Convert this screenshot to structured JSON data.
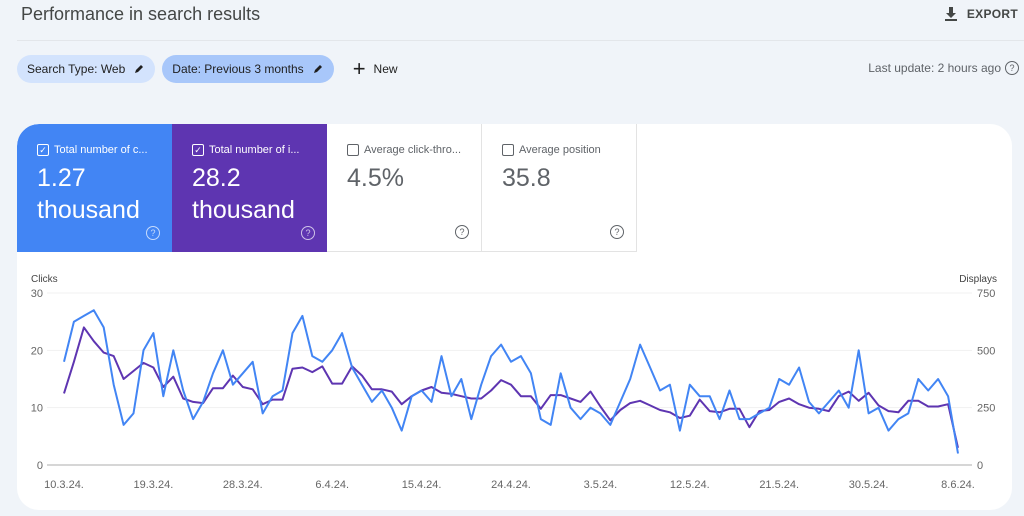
{
  "header": {
    "title": "Performance in search results",
    "export_label": "EXPORT"
  },
  "filters": {
    "chips": [
      {
        "label": "Search Type: Web"
      },
      {
        "label": "Date: Previous 3 months"
      }
    ],
    "new_label": "New",
    "last_update": "Last update: 2 hours ago"
  },
  "metrics": [
    {
      "label": "Total number of c...",
      "value_line1": "1.27",
      "value_line2": "thousand",
      "checked": true,
      "color": "#4285f4"
    },
    {
      "label": "Total number of i...",
      "value_line1": "28.2",
      "value_line2": "thousand",
      "checked": true,
      "color": "#5e35b1"
    },
    {
      "label": "Average click-thro...",
      "value_line1": "4.5%",
      "value_line2": "",
      "checked": false
    },
    {
      "label": "Average position",
      "value_line1": "35.8",
      "value_line2": "",
      "checked": false
    }
  ],
  "chart_data": {
    "type": "line",
    "ylabel_left": "Clicks",
    "ylabel_right": "Displays",
    "ylim_left": [
      0,
      30
    ],
    "ylim_right": [
      0,
      750
    ],
    "yticks_left": [
      "0",
      "10",
      "20",
      "30"
    ],
    "yticks_right": [
      "0",
      "250",
      "500",
      "750"
    ],
    "xtick_labels": [
      "10.3.24.",
      "19.3.24.",
      "28.3.24.",
      "6.4.24.",
      "15.4.24.",
      "24.4.24.",
      "3.5.24.",
      "12.5.24.",
      "21.5.24.",
      "30.5.24.",
      "8.6.24."
    ],
    "grid": true,
    "series": [
      {
        "name": "Clicks",
        "axis": "left",
        "color": "#4285f4",
        "values": [
          18,
          25,
          26,
          27,
          24,
          14,
          7,
          9,
          20,
          23,
          12,
          20,
          13,
          8,
          11,
          16,
          20,
          14,
          16,
          18,
          9,
          12,
          13,
          23,
          26,
          19,
          18,
          20,
          23,
          17,
          14,
          11,
          13,
          10,
          6,
          12,
          13,
          11,
          19,
          12,
          15,
          8,
          14,
          19,
          21,
          18,
          19,
          16,
          8,
          7,
          16,
          10,
          8,
          10,
          9,
          7,
          11,
          15,
          21,
          17,
          13,
          14,
          6,
          14,
          12,
          12,
          8,
          13,
          8,
          8,
          9,
          10,
          15,
          14,
          17,
          11,
          9,
          11,
          13,
          10,
          20,
          9,
          10,
          6,
          8,
          9,
          15,
          13,
          15,
          12,
          2
        ]
      },
      {
        "name": "Displays",
        "axis": "right",
        "color": "#5e35b1",
        "values": [
          312,
          450,
          600,
          540,
          490,
          475,
          375,
          410,
          445,
          425,
          340,
          385,
          290,
          275,
          270,
          335,
          335,
          390,
          340,
          330,
          265,
          285,
          285,
          420,
          425,
          405,
          430,
          355,
          355,
          430,
          390,
          330,
          330,
          320,
          265,
          300,
          325,
          340,
          315,
          310,
          300,
          290,
          290,
          325,
          370,
          350,
          300,
          300,
          245,
          305,
          305,
          290,
          275,
          320,
          255,
          195,
          240,
          270,
          280,
          260,
          240,
          230,
          205,
          215,
          285,
          235,
          230,
          245,
          245,
          165,
          235,
          240,
          275,
          290,
          265,
          250,
          245,
          235,
          300,
          320,
          280,
          315,
          260,
          235,
          230,
          280,
          280,
          255,
          255,
          265,
          75
        ]
      }
    ]
  }
}
